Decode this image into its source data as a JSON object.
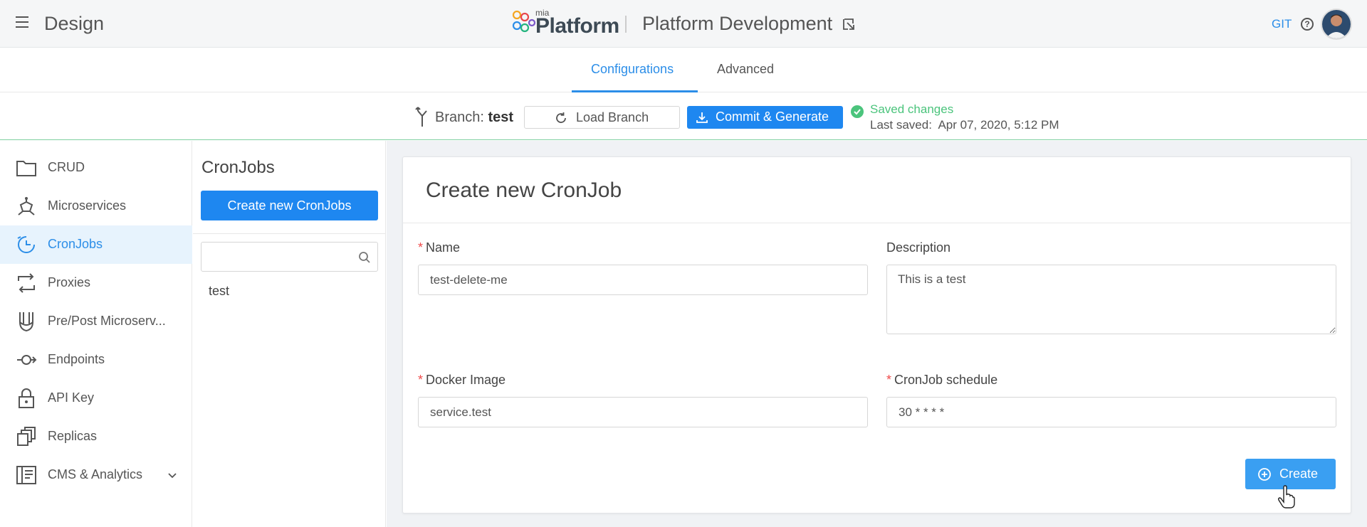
{
  "header": {
    "section_title": "Design",
    "logo_small": "mia",
    "logo_main": "Platform",
    "project_name": "Platform Development",
    "git_label": "GIT",
    "help_label": "?"
  },
  "tabs": [
    {
      "label": "Configurations",
      "active": true
    },
    {
      "label": "Advanced",
      "active": false
    }
  ],
  "branch_bar": {
    "branch_prefix": "Branch: ",
    "branch_name": "test",
    "load_branch_label": "Load Branch",
    "commit_label": "Commit & Generate",
    "saved_status": "Saved changes",
    "last_saved": "Last saved:  Apr 07, 2020, 5:12 PM"
  },
  "sidebar": {
    "items": [
      {
        "label": "CRUD",
        "icon": "folder-icon"
      },
      {
        "label": "Microservices",
        "icon": "microservices-icon"
      },
      {
        "label": "CronJobs",
        "icon": "clock-icon",
        "active": true
      },
      {
        "label": "Proxies",
        "icon": "proxy-icon"
      },
      {
        "label": "Pre/Post Microserv...",
        "icon": "decorator-icon"
      },
      {
        "label": "Endpoints",
        "icon": "endpoint-icon"
      },
      {
        "label": "API Key",
        "icon": "lock-icon"
      },
      {
        "label": "Replicas",
        "icon": "replicas-icon"
      },
      {
        "label": "CMS & Analytics",
        "icon": "cms-icon"
      }
    ]
  },
  "list_panel": {
    "title": "CronJobs",
    "create_button": "Create new CronJobs",
    "search_placeholder": "",
    "items": [
      "test"
    ]
  },
  "form": {
    "title": "Create new CronJob",
    "name_label": "Name",
    "name_value": "test-delete-me",
    "description_label": "Description",
    "description_value": "This is a test",
    "docker_label": "Docker Image",
    "docker_value": "service.test",
    "schedule_label": "CronJob schedule",
    "schedule_value": "30 * * * *",
    "create_button": "Create"
  },
  "colors": {
    "accent": "#1e87f0",
    "success": "#4bc47c",
    "required": "#f04b4b"
  }
}
